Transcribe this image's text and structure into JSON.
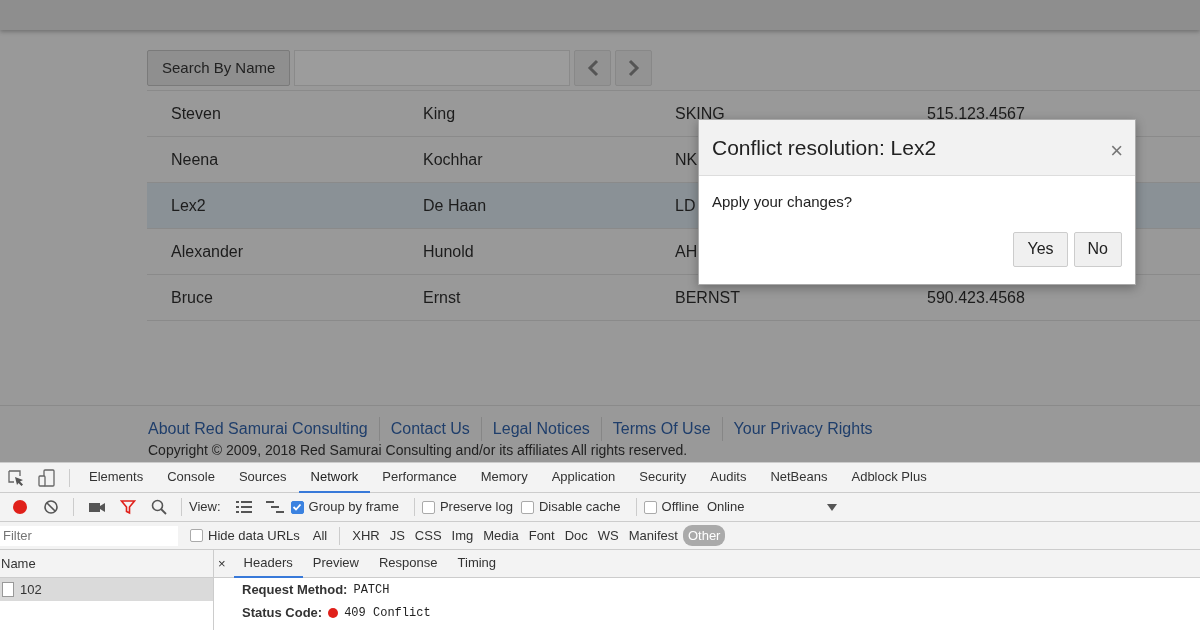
{
  "search": {
    "button": "Search By Name"
  },
  "table": {
    "rows": [
      {
        "cells": [
          "Steven",
          "King",
          "SKING",
          "515.123.4567"
        ],
        "selected": false
      },
      {
        "cells": [
          "Neena",
          "Kochhar",
          "NK"
        ],
        "selected": false
      },
      {
        "cells": [
          "Lex2",
          "De Haan",
          "LD"
        ],
        "selected": true
      },
      {
        "cells": [
          "Alexander",
          "Hunold",
          "AH"
        ],
        "selected": false
      },
      {
        "cells": [
          "Bruce",
          "Ernst",
          "BERNST",
          "590.423.4568"
        ],
        "selected": false
      }
    ]
  },
  "dialog": {
    "title": "Conflict resolution: Lex2",
    "close": "×",
    "message": "Apply your changes?",
    "buttons": [
      "Yes",
      "No"
    ]
  },
  "footer": {
    "links": [
      "About Red Samurai Consulting",
      "Contact Us",
      "Legal Notices",
      "Terms Of Use",
      "Your Privacy Rights"
    ],
    "copyright": "Copyright © 2009, 2018 Red Samurai Consulting and/or its affiliates All rights reserved."
  },
  "devtools": {
    "tabs": [
      {
        "label": "Elements",
        "selected": false
      },
      {
        "label": "Console",
        "selected": false
      },
      {
        "label": "Sources",
        "selected": false
      },
      {
        "label": "Network",
        "selected": true
      },
      {
        "label": "Performance",
        "selected": false
      },
      {
        "label": "Memory",
        "selected": false
      },
      {
        "label": "Application",
        "selected": false
      },
      {
        "label": "Security",
        "selected": false
      },
      {
        "label": "Audits",
        "selected": false
      },
      {
        "label": "NetBeans",
        "selected": false
      },
      {
        "label": "Adblock Plus",
        "selected": false
      }
    ],
    "recording": true,
    "view_label": "View:",
    "options": [
      {
        "label": "Group by frame",
        "checked": true
      },
      {
        "label": "Preserve log",
        "checked": false
      },
      {
        "label": "Disable cache",
        "checked": false
      },
      {
        "label": "Offline",
        "checked": false
      }
    ],
    "throttle": "Online",
    "filter_placeholder": "Filter",
    "hide_data_urls": {
      "label": "Hide data URLs",
      "checked": false
    },
    "types": [
      {
        "label": "All",
        "selected": false
      },
      {
        "label": "XHR",
        "selected": false
      },
      {
        "label": "JS",
        "selected": false
      },
      {
        "label": "CSS",
        "selected": false
      },
      {
        "label": "Img",
        "selected": false
      },
      {
        "label": "Media",
        "selected": false
      },
      {
        "label": "Font",
        "selected": false
      },
      {
        "label": "Doc",
        "selected": false
      },
      {
        "label": "WS",
        "selected": false
      },
      {
        "label": "Manifest",
        "selected": false
      },
      {
        "label": "Other",
        "selected": true
      }
    ],
    "name_header": "Name",
    "requests": [
      {
        "name": "102",
        "selected": true
      }
    ],
    "detail_close": "×",
    "detail_tabs": [
      {
        "label": "Headers",
        "selected": true
      },
      {
        "label": "Preview",
        "selected": false
      },
      {
        "label": "Response",
        "selected": false
      },
      {
        "label": "Timing",
        "selected": false
      }
    ],
    "headers": [
      {
        "key": "Request Method:",
        "value": "PATCH"
      },
      {
        "key": "Status Code:",
        "value": "409 Conflict",
        "color": "#e0201a"
      }
    ]
  }
}
